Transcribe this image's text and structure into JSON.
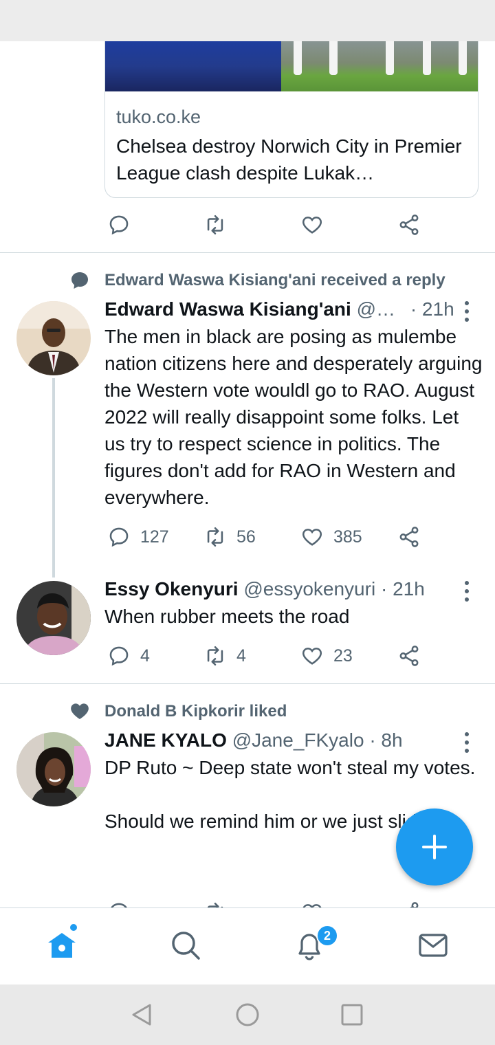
{
  "link_card": {
    "domain": "tuko.co.ke",
    "title": "Chelsea destroy Norwich City in Premier League clash despite Lukak…"
  },
  "tweets": [
    {
      "social_context": "Edward Waswa Kisiang'ani received a reply",
      "social_icon": "reply-bubble-icon",
      "name": "Edward Waswa Kisiang'ani",
      "handle": "@…",
      "time": "· 21h",
      "text": "The men in black are posing as mulembe nation citizens here and desperately arguing the Western vote wouldl go to RAO. August 2022 will really disappoint some folks. Let us try to respect science in politics. The figures don't add for RAO in Western and everywhere.",
      "replies": "127",
      "retweets": "56",
      "likes": "385"
    },
    {
      "name": "Essy Okenyuri",
      "handle": "@essyokenyuri",
      "time": "· 21h",
      "text": "When rubber meets the road",
      "replies": "4",
      "retweets": "4",
      "likes": "23"
    },
    {
      "social_context": "Donald B Kipkorir liked",
      "social_icon": "heart-filled-icon",
      "name": "JANE KYALO",
      "handle": "@Jane_FKyalo",
      "time": "· 8h",
      "text": "DP Ruto ~ Deep state won't steal my votes.\n\nShould we remind him or we just slide?"
    }
  ],
  "tabbar": {
    "items": [
      "home-icon",
      "search-icon",
      "notifications-icon",
      "messages-icon"
    ],
    "notification_badge": "2"
  },
  "colors": {
    "accent": "#1d9bf0",
    "secondary_text": "#536471",
    "border": "#cfd9de"
  }
}
